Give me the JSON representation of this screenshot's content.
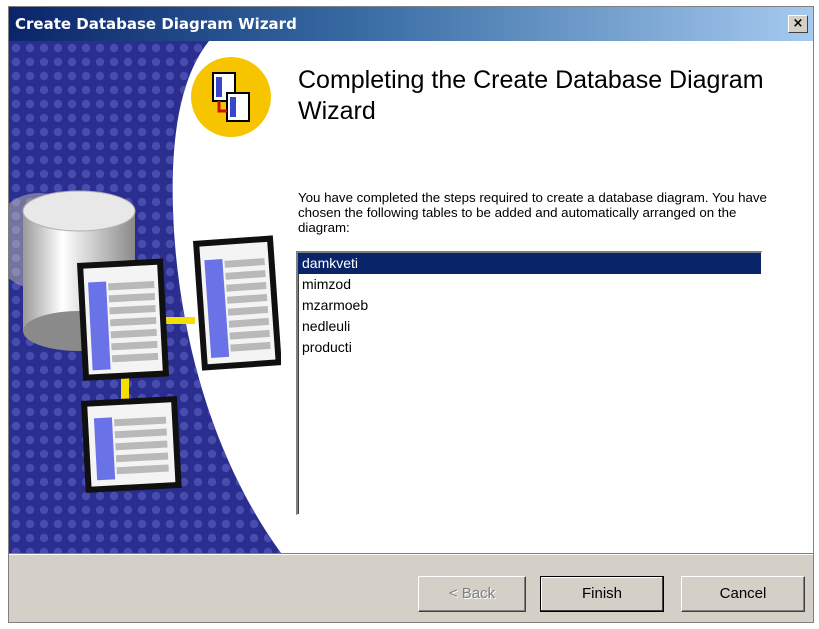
{
  "window": {
    "title": "Create Database Diagram Wizard",
    "close_label": "×"
  },
  "page": {
    "heading": "Completing the Create Database Diagram Wizard",
    "description": "You have completed the steps required to create a database diagram. You have chosen the following tables to be added and automatically arranged on the diagram:"
  },
  "tables": {
    "items": [
      "damkveti",
      "mimzod",
      "mzarmoeb",
      "nedleuli",
      "producti"
    ],
    "selected_index": 0
  },
  "buttons": {
    "back": "< Back",
    "finish": "Finish",
    "cancel": "Cancel"
  },
  "icons": {
    "wizard_icon": "diagram-wizard-icon",
    "side_art": "database-tables-illustration"
  },
  "colors": {
    "title_bar": "#0a246a",
    "side_panel": "#2b2f8c",
    "selection": "#0a246a",
    "icon_circle": "#f7c400"
  }
}
